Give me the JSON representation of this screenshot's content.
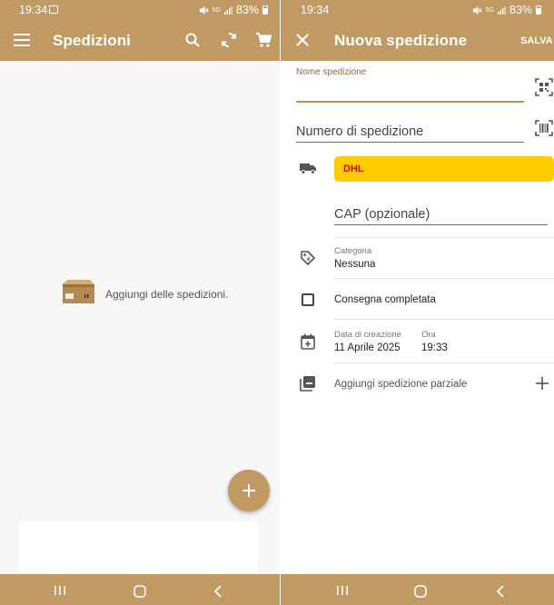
{
  "left_screen": {
    "status": {
      "time": "19:34",
      "network_label": "5G",
      "battery": "83%"
    },
    "appbar": {
      "title": "Spedizioni",
      "icons": [
        "menu-icon",
        "search-icon",
        "sync-icon",
        "cart-icon"
      ]
    },
    "empty_state": {
      "icon": "package-box-icon",
      "text": "Aggiungi delle spedizioni."
    },
    "fab": {
      "icon": "plus-icon"
    }
  },
  "right_screen": {
    "status": {
      "time": "19:34",
      "network_label": "5G",
      "battery": "83%"
    },
    "appbar": {
      "title": "Nuova spedizione",
      "save_label": "SALVA",
      "close_icon": "close-icon"
    },
    "form": {
      "name_label": "Nome spedizione",
      "name_value": "",
      "tracking_placeholder": "Numero di spedizione",
      "carrier": {
        "name": "DHL",
        "background": "#ffcc00",
        "color": "#d40511"
      },
      "zip_placeholder": "CAP (opzionale)",
      "category": {
        "label": "Categoria",
        "value": "Nessuna"
      },
      "delivered": {
        "label": "Consegna completata",
        "checked": false
      },
      "creation": {
        "date_label": "Data di creazione",
        "date_value": "11 Aprile 2025",
        "time_label": "Ora",
        "time_value": "19:33"
      },
      "partial": {
        "label": "Aggiungi spedizione parziale"
      }
    }
  },
  "colors": {
    "accent": "#c19a63",
    "dhl_yellow": "#ffcc00",
    "dhl_red": "#d40511"
  }
}
